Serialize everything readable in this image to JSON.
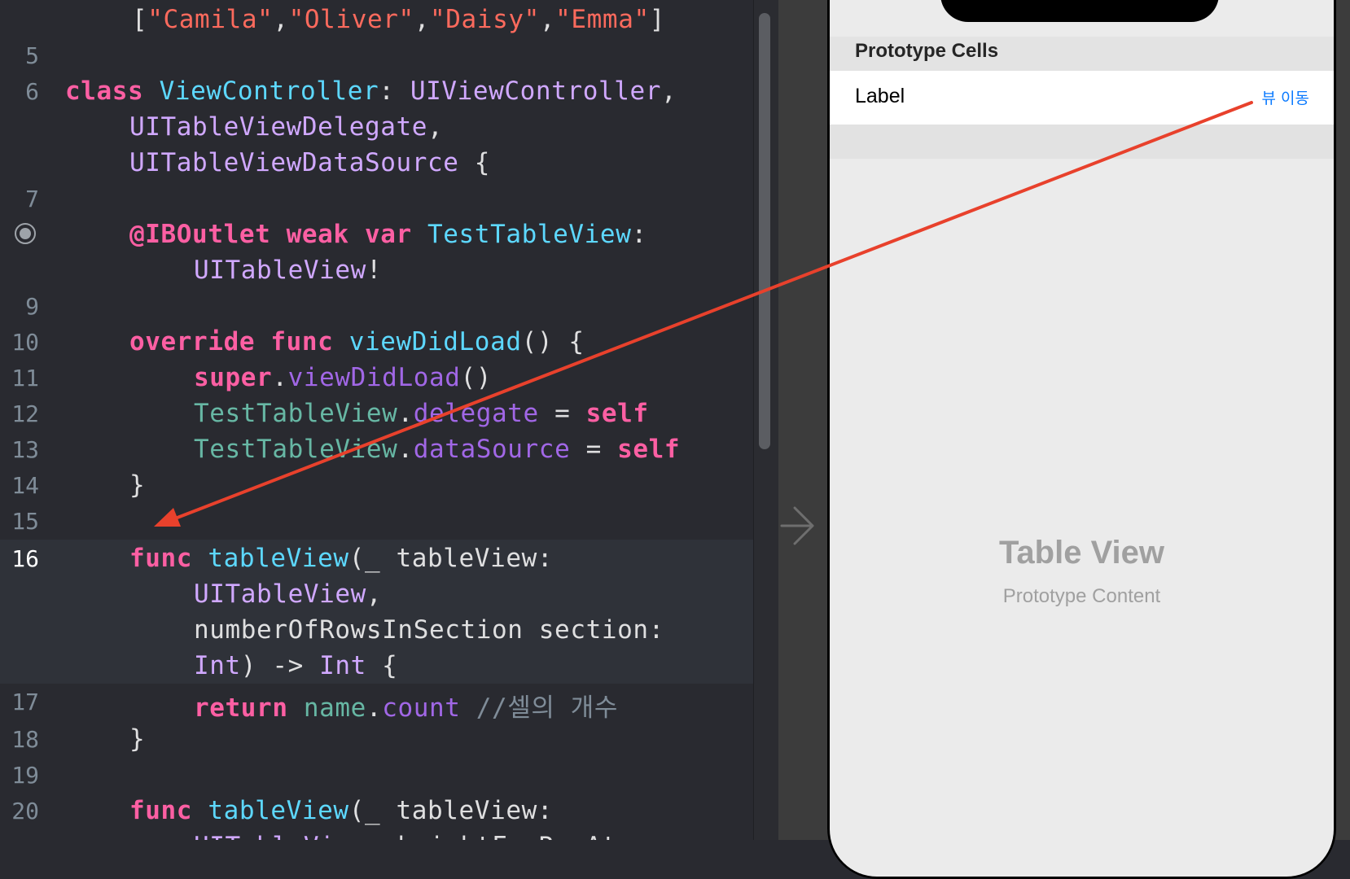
{
  "editor": {
    "lines": [
      {
        "ln": "",
        "tokens": [
          {
            "c": "pl",
            "t": "["
          },
          {
            "c": "str",
            "t": "\"Camila\""
          },
          {
            "c": "pl",
            "t": ","
          },
          {
            "c": "str",
            "t": "\"Oliver\""
          },
          {
            "c": "pl",
            "t": ","
          },
          {
            "c": "str",
            "t": "\"Daisy\""
          },
          {
            "c": "pl",
            "t": ","
          },
          {
            "c": "str",
            "t": "\"Emma\""
          },
          {
            "c": "pl",
            "t": "]"
          }
        ]
      },
      {
        "ln": "5",
        "tokens": []
      },
      {
        "ln": "6",
        "tokens": [
          {
            "c": "kw",
            "t": "class"
          },
          {
            "c": "pl",
            "t": " "
          },
          {
            "c": "decl",
            "t": "ViewController"
          },
          {
            "c": "pl",
            "t": ": "
          },
          {
            "c": "typ",
            "t": "UIViewController"
          },
          {
            "c": "pl",
            "t": ","
          }
        ]
      },
      {
        "ln": "",
        "tokens": [
          {
            "c": "typ",
            "t": "UITableViewDelegate"
          },
          {
            "c": "pl",
            "t": ","
          }
        ]
      },
      {
        "ln": "",
        "tokens": [
          {
            "c": "typ",
            "t": "UITableViewDataSource"
          },
          {
            "c": "pl",
            "t": " {"
          }
        ]
      },
      {
        "ln": "7",
        "tokens": []
      },
      {
        "ln": "",
        "tokens": [
          {
            "c": "kw",
            "t": "@IBOutlet"
          },
          {
            "c": "pl",
            "t": " "
          },
          {
            "c": "kw",
            "t": "weak"
          },
          {
            "c": "pl",
            "t": " "
          },
          {
            "c": "kw",
            "t": "var"
          },
          {
            "c": "pl",
            "t": " "
          },
          {
            "c": "decl",
            "t": "TestTableView"
          },
          {
            "c": "pl",
            "t": ":"
          }
        ]
      },
      {
        "ln": "",
        "tokens": [
          {
            "c": "typ",
            "t": "UITableView"
          },
          {
            "c": "pl",
            "t": "!"
          }
        ]
      },
      {
        "ln": "9",
        "tokens": []
      },
      {
        "ln": "10",
        "tokens": [
          {
            "c": "kw",
            "t": "override"
          },
          {
            "c": "pl",
            "t": " "
          },
          {
            "c": "kw",
            "t": "func"
          },
          {
            "c": "pl",
            "t": " "
          },
          {
            "c": "decl",
            "t": "viewDidLoad"
          },
          {
            "c": "pl",
            "t": "() {"
          }
        ]
      },
      {
        "ln": "11",
        "tokens": [
          {
            "c": "kw",
            "t": "super"
          },
          {
            "c": "pl",
            "t": "."
          },
          {
            "c": "mem",
            "t": "viewDidLoad"
          },
          {
            "c": "pl",
            "t": "()"
          }
        ]
      },
      {
        "ln": "12",
        "tokens": [
          {
            "c": "proj",
            "t": "TestTableView"
          },
          {
            "c": "pl",
            "t": "."
          },
          {
            "c": "mem",
            "t": "delegate"
          },
          {
            "c": "pl",
            "t": " = "
          },
          {
            "c": "kw",
            "t": "self"
          }
        ]
      },
      {
        "ln": "13",
        "tokens": [
          {
            "c": "proj",
            "t": "TestTableView"
          },
          {
            "c": "pl",
            "t": "."
          },
          {
            "c": "mem",
            "t": "dataSource"
          },
          {
            "c": "pl",
            "t": " = "
          },
          {
            "c": "kw",
            "t": "self"
          }
        ]
      },
      {
        "ln": "14",
        "tokens": [
          {
            "c": "pl",
            "t": "}"
          }
        ]
      },
      {
        "ln": "15",
        "tokens": []
      },
      {
        "ln": "16",
        "current": true,
        "tokens": [
          {
            "c": "kw",
            "t": "func"
          },
          {
            "c": "pl",
            "t": " "
          },
          {
            "c": "decl",
            "t": "tableView"
          },
          {
            "c": "pl",
            "t": "(_ tableView:"
          }
        ]
      },
      {
        "ln": "",
        "tokens": [
          {
            "c": "typ",
            "t": "UITableView"
          },
          {
            "c": "pl",
            "t": ","
          }
        ]
      },
      {
        "ln": "",
        "tokens": [
          {
            "c": "pl",
            "t": "numberOfRowsInSection section:"
          }
        ]
      },
      {
        "ln": "",
        "tokens": [
          {
            "c": "typ",
            "t": "Int"
          },
          {
            "c": "pl",
            "t": ") -> "
          },
          {
            "c": "typ",
            "t": "Int"
          },
          {
            "c": "pl",
            "t": " {"
          }
        ]
      },
      {
        "ln": "17",
        "tokens": [
          {
            "c": "kw",
            "t": "return"
          },
          {
            "c": "pl",
            "t": " "
          },
          {
            "c": "proj",
            "t": "name"
          },
          {
            "c": "pl",
            "t": "."
          },
          {
            "c": "mem",
            "t": "count"
          },
          {
            "c": "pl",
            "t": " "
          },
          {
            "c": "cmt",
            "t": "//셀의 개수"
          }
        ]
      },
      {
        "ln": "18",
        "tokens": [
          {
            "c": "pl",
            "t": "}"
          }
        ]
      },
      {
        "ln": "19",
        "tokens": []
      },
      {
        "ln": "20",
        "tokens": [
          {
            "c": "kw",
            "t": "func"
          },
          {
            "c": "pl",
            "t": " "
          },
          {
            "c": "decl",
            "t": "tableView"
          },
          {
            "c": "pl",
            "t": "(_ tableView:"
          }
        ]
      },
      {
        "ln": "",
        "tokens": [
          {
            "c": "typ",
            "t": "UITableView"
          },
          {
            "c": "pl",
            "t": ", heightForRowAt"
          }
        ]
      }
    ]
  },
  "storyboard": {
    "section_title": "Prototype Cells",
    "cell_label": "Label",
    "cell_button": "뷰 이동",
    "table_view_title": "Table View",
    "table_view_subtitle": "Prototype Content"
  },
  "colors": {
    "editor_bg": "#292a30",
    "keyword": "#fc5fa3",
    "string": "#fc6a5d",
    "type": "#d0a8ff",
    "declaration": "#5dd8ff",
    "project": "#67b7a4",
    "member": "#a167e6",
    "comment": "#7f8c98",
    "connection_arrow": "#e8412c",
    "ios_blue": "#0a7aff"
  },
  "icons": {
    "breakpoint": "breakpoint-icon",
    "segue": "segue-arrow-icon"
  }
}
